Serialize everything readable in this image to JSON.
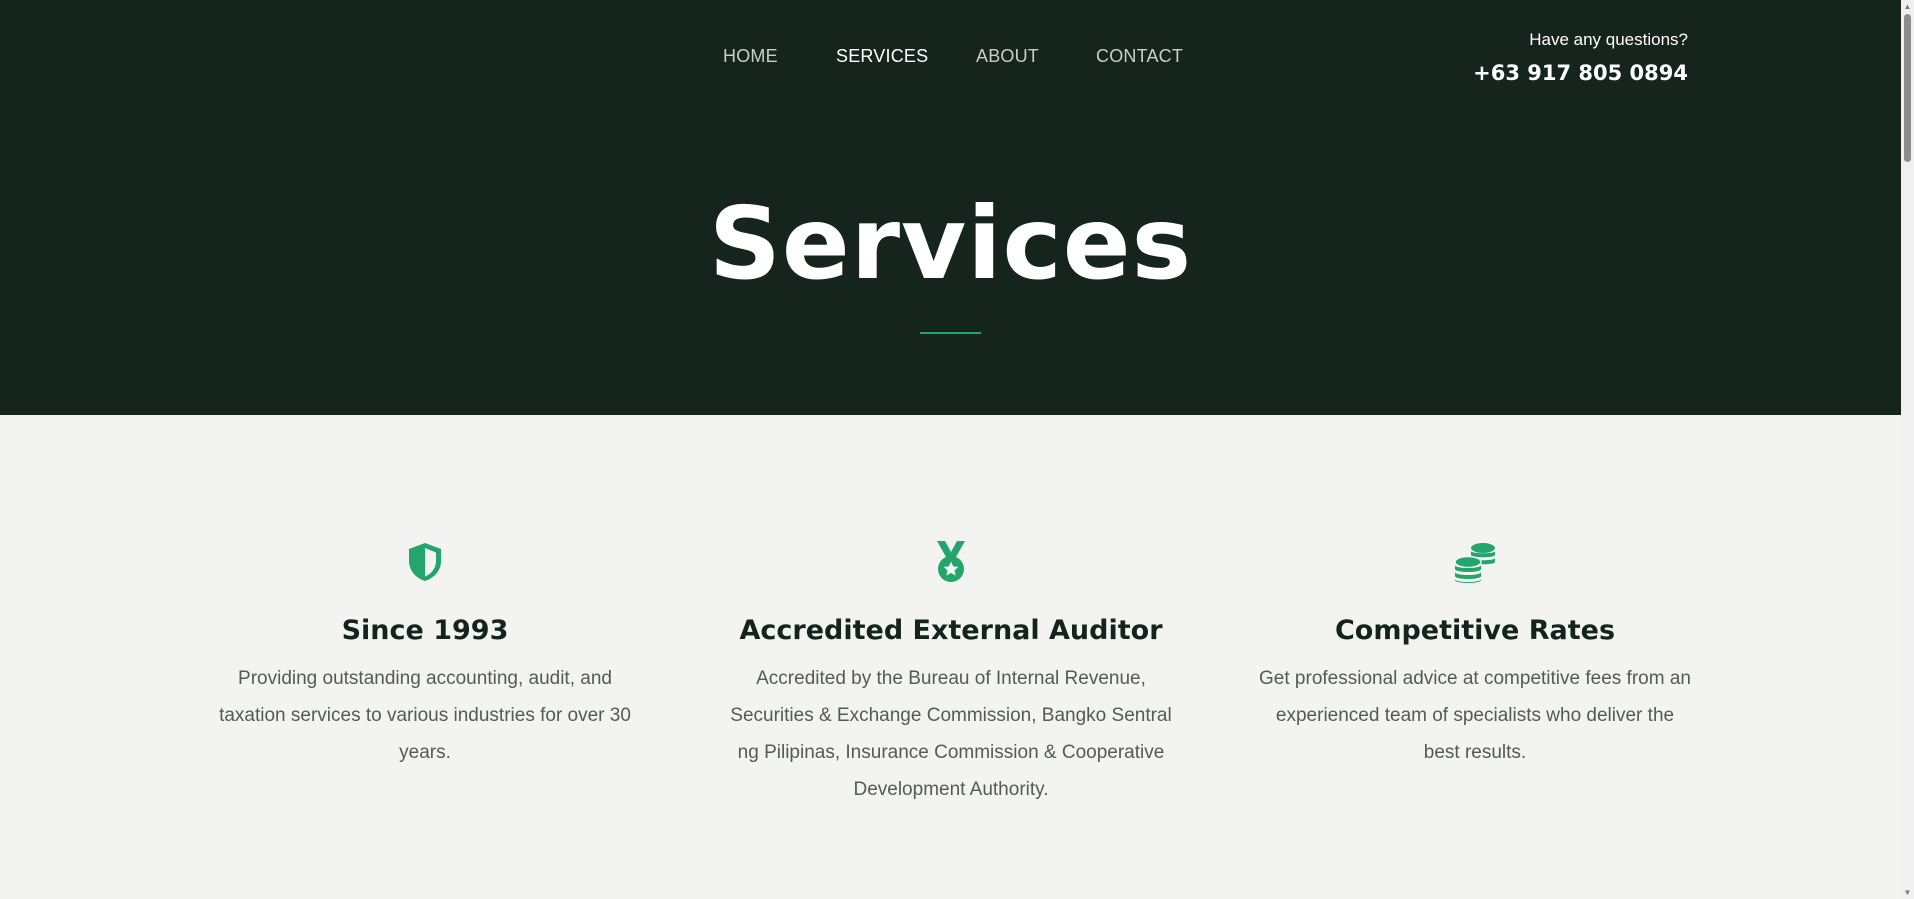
{
  "nav": {
    "items": [
      {
        "label": "HOME",
        "active": false
      },
      {
        "label": "SERVICES",
        "active": true
      },
      {
        "label": "ABOUT",
        "active": false
      },
      {
        "label": "CONTACT",
        "active": false
      }
    ]
  },
  "contact": {
    "question": "Have any questions?",
    "phone": "+63 917 805 0894"
  },
  "hero": {
    "title": "Services"
  },
  "features": [
    {
      "icon": "shield-icon",
      "title": "Since 1993",
      "text": "Providing outstanding accounting, audit, and taxation services to various industries for over 30 years."
    },
    {
      "icon": "medal-icon",
      "title": "Accredited External Auditor",
      "text": "Accredited by the Bureau of Internal Revenue, Securities & Exchange Commission, Bangko Sentral ng Pilipinas, Insurance Commission & Cooperative Development Authority."
    },
    {
      "icon": "coins-icon",
      "title": "Competitive Rates",
      "text": "Get professional advice at competitive fees from an experienced team of specialists who deliver the best results."
    }
  ],
  "colors": {
    "hero_bg": "#15241c",
    "accent": "#23a56b",
    "page_bg": "#f3f4f2",
    "heading": "#13241b",
    "body_text": "#555a57"
  }
}
